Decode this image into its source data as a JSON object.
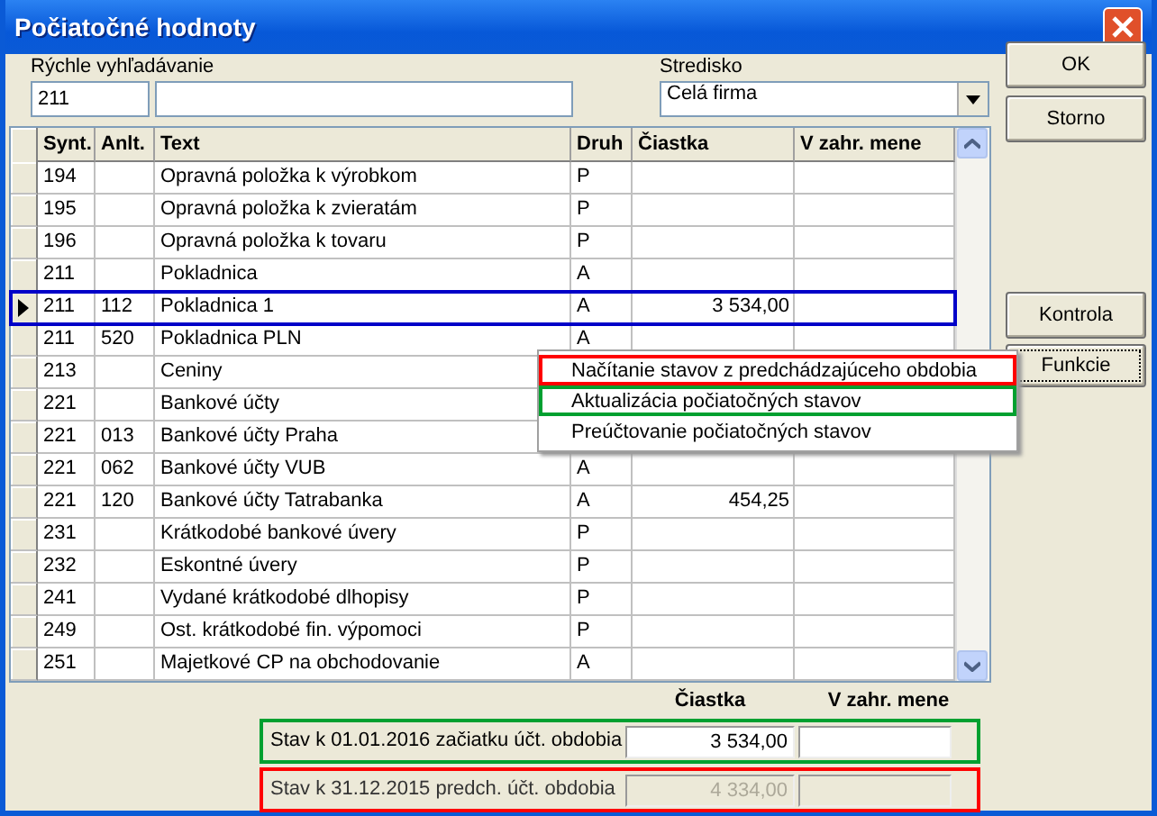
{
  "window": {
    "title": "Počiatočné hodnoty"
  },
  "search": {
    "label": "Rýchle vyhľadávanie",
    "value": "211"
  },
  "stredisko": {
    "label": "Stredisko",
    "value": "Celá firma"
  },
  "buttons": [
    {
      "label": "OK",
      "kind": "main"
    },
    {
      "label": "Storno",
      "kind": "main"
    },
    {
      "label": "Kontrola",
      "kind": "side"
    },
    {
      "label": "Funkcie",
      "kind": "focused"
    }
  ],
  "grid": {
    "columns": [
      "Synt.",
      "Anlt.",
      "Text",
      "Druh",
      "Čiastka",
      "V zahr. mene"
    ],
    "rows": [
      {
        "cells": [
          "194",
          "",
          "Opravná položka k výrobkom",
          "P",
          "",
          ""
        ],
        "selected": false
      },
      {
        "cells": [
          "195",
          "",
          "Opravná položka k zvieratám",
          "P",
          "",
          ""
        ],
        "selected": false
      },
      {
        "cells": [
          "196",
          "",
          "Opravná položka k tovaru",
          "P",
          "",
          ""
        ],
        "selected": false
      },
      {
        "cells": [
          "211",
          "",
          "Pokladnica",
          "A",
          "",
          ""
        ],
        "selected": false
      },
      {
        "cells": [
          "211",
          "112",
          "Pokladnica 1",
          "A",
          "3 534,00",
          ""
        ],
        "selected": true
      },
      {
        "cells": [
          "211",
          "520",
          "Pokladnica PLN",
          "A",
          "",
          ""
        ],
        "selected": false
      },
      {
        "cells": [
          "213",
          "",
          "Ceniny",
          "",
          "",
          ""
        ],
        "selected": false
      },
      {
        "cells": [
          "221",
          "",
          "Bankové účty",
          "",
          "",
          ""
        ],
        "selected": false
      },
      {
        "cells": [
          "221",
          "013",
          "Bankové účty Praha",
          "",
          "",
          ""
        ],
        "selected": false
      },
      {
        "cells": [
          "221",
          "062",
          "Bankové účty VUB",
          "A",
          "",
          ""
        ],
        "selected": false
      },
      {
        "cells": [
          "221",
          "120",
          "Bankové účty Tatrabanka",
          "A",
          "454,25",
          ""
        ],
        "selected": false
      },
      {
        "cells": [
          "231",
          "",
          "Krátkodobé bankové úvery",
          "P",
          "",
          ""
        ],
        "selected": false
      },
      {
        "cells": [
          "232",
          "",
          "Eskontné úvery",
          "P",
          "",
          ""
        ],
        "selected": false
      },
      {
        "cells": [
          "241",
          "",
          "Vydané krátkodobé dlhopisy",
          "P",
          "",
          ""
        ],
        "selected": false
      },
      {
        "cells": [
          "249",
          "",
          "Ost. krátkodobé fin. výpomoci",
          "P",
          "",
          ""
        ],
        "selected": false
      },
      {
        "cells": [
          "251",
          "",
          "Majetkové CP na obchodovanie",
          "A",
          "",
          ""
        ],
        "selected": false
      }
    ]
  },
  "menu": [
    {
      "label": "Načítanie stavov z predchádzajúceho obdobia",
      "color": "#ff0000"
    },
    {
      "label": "Aktualizácia počiatočných stavov",
      "color": "#00a030"
    },
    {
      "label": "Preúčtovanie počiatočných stavov"
    }
  ],
  "totals": {
    "columns": [
      "Čiastka",
      "V zahr. mene"
    ],
    "rows": [
      {
        "label": "Stav k 01.01.2016 začiatku účt. obdobia",
        "amount": "3 534,00",
        "foreign": "",
        "disabled": false,
        "color": "#00a030"
      },
      {
        "label": "Stav k 31.12.2015 predch. účt. obdobia",
        "amount": "4 334,00",
        "foreign": "",
        "disabled": true,
        "color": "#ff0000"
      }
    ]
  }
}
